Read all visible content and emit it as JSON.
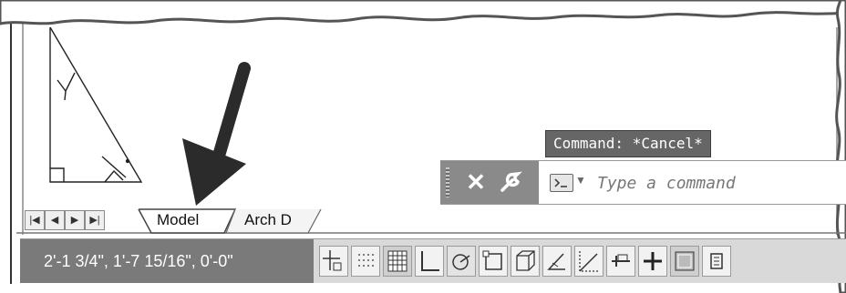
{
  "command_line": {
    "history_text": "Command: *Cancel*",
    "input_placeholder": "Type a command",
    "icons": [
      "close-icon",
      "wrench-icon",
      "command-prompt-icon",
      "dropdown-arrow-icon"
    ]
  },
  "layout_tabs": {
    "nav_buttons": [
      "first-tab-icon",
      "previous-tab-icon",
      "next-tab-icon",
      "last-tab-icon"
    ],
    "tabs": [
      "Model",
      "Arch D"
    ],
    "active_tab": "Model"
  },
  "status_bar": {
    "coordinates": "2'-1 3/4\",   1'-7 15/16\", 0'-0\"",
    "toggle_icons": [
      "infer-constraints-icon",
      "snap-mode-icon",
      "grid-display-icon",
      "ortho-mode-icon",
      "polar-tracking-icon",
      "object-snap-icon",
      "3d-object-snap-icon",
      "dynamic-ucs-icon",
      "dynamic-input-icon",
      "lineweight-icon",
      "show-hide-transparency-icon",
      "quick-properties-icon",
      "selection-cycling-icon"
    ]
  },
  "colors": {
    "status_coords_bg": "#7a7a7a",
    "command_bg": "#666666",
    "arrow": "#2b2b2b"
  }
}
